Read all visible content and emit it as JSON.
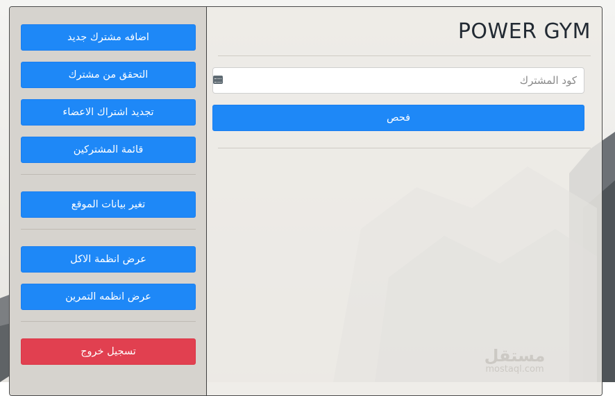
{
  "sidebar": {
    "group1": [
      {
        "label": "اضافه مشترك جديد"
      },
      {
        "label": "التحقق من مشترك"
      },
      {
        "label": "تجديد اشتراك الاعضاء"
      },
      {
        "label": "قائمة المشتركين"
      }
    ],
    "group2": [
      {
        "label": "تغير بيانات الموقع"
      }
    ],
    "group3": [
      {
        "label": "عرض انظمة الاكل"
      },
      {
        "label": "عرض انظمه التمرين"
      }
    ],
    "logout_label": "تسجيل خروج"
  },
  "main": {
    "title": "POWER GYM",
    "code_input": {
      "placeholder": "كود المشترك",
      "value": ""
    },
    "check_label": "فحص"
  },
  "watermark": {
    "arabic": "مستقل",
    "latin": "mostaql.com"
  },
  "colors": {
    "primary": "#1e88f7",
    "danger": "#e14050",
    "sidebar_bg": "#d6d3ce"
  }
}
